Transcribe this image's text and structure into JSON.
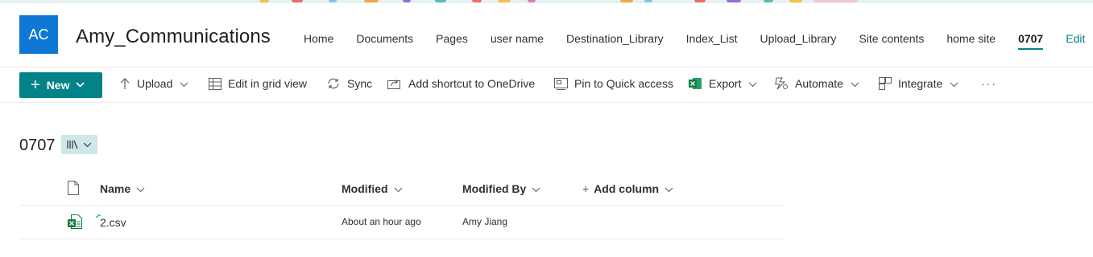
{
  "site": {
    "logo_initials": "AC",
    "title": "Amy_Communications"
  },
  "nav": {
    "items": [
      "Home",
      "Documents",
      "Pages",
      "user name",
      "Destination_Library",
      "Index_List",
      "Upload_Library",
      "Site contents",
      "home site",
      "0707"
    ],
    "active": "0707",
    "edit_label": "Edit"
  },
  "commands": {
    "new_label": "New",
    "upload": "Upload",
    "grid": "Edit in grid view",
    "sync": "Sync",
    "shortcut": "Add shortcut to OneDrive",
    "pin": "Pin to Quick access",
    "export": "Export",
    "automate": "Automate",
    "integrate": "Integrate",
    "more": "···"
  },
  "library": {
    "title": "0707"
  },
  "columns": {
    "name": "Name",
    "modified": "Modified",
    "modified_by": "Modified By",
    "add_column": "Add column"
  },
  "rows": [
    {
      "name": "2.csv",
      "modified": "About an hour ago",
      "modified_by": "Amy Jiang",
      "icon": "excel-csv-icon"
    }
  ],
  "colors": {
    "accent": "#038387",
    "logo": "#0f78d4",
    "view_button": "#cde7ea"
  }
}
